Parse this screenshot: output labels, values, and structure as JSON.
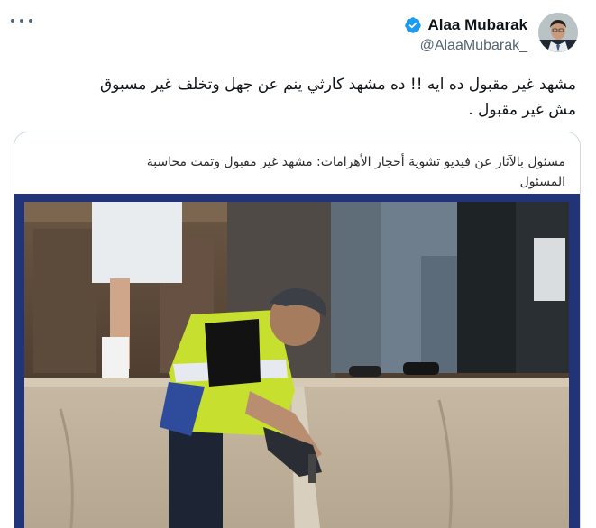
{
  "author": {
    "display_name": "Alaa Mubarak",
    "handle": "@AlaaMubarak_",
    "verified": true,
    "verified_color": "#1d9bf0"
  },
  "tweet": {
    "text_line_1": "مشهد غير مقبول ده ايه !! ده مشهد كارثي ينم عن جهل وتخلف غير مسبوق",
    "text_line_2": "مش غير مقبول ."
  },
  "card": {
    "headline_line_1": "مسئول بالآثار عن فيديو تشوية أحجار الأهرامات: مشهد غير مقبول وتمت محاسبة",
    "headline_line_2": "المسئول",
    "frame_color": "#21347a"
  },
  "icons": {
    "more": "more-options-icon",
    "verified": "verified-badge-icon"
  }
}
